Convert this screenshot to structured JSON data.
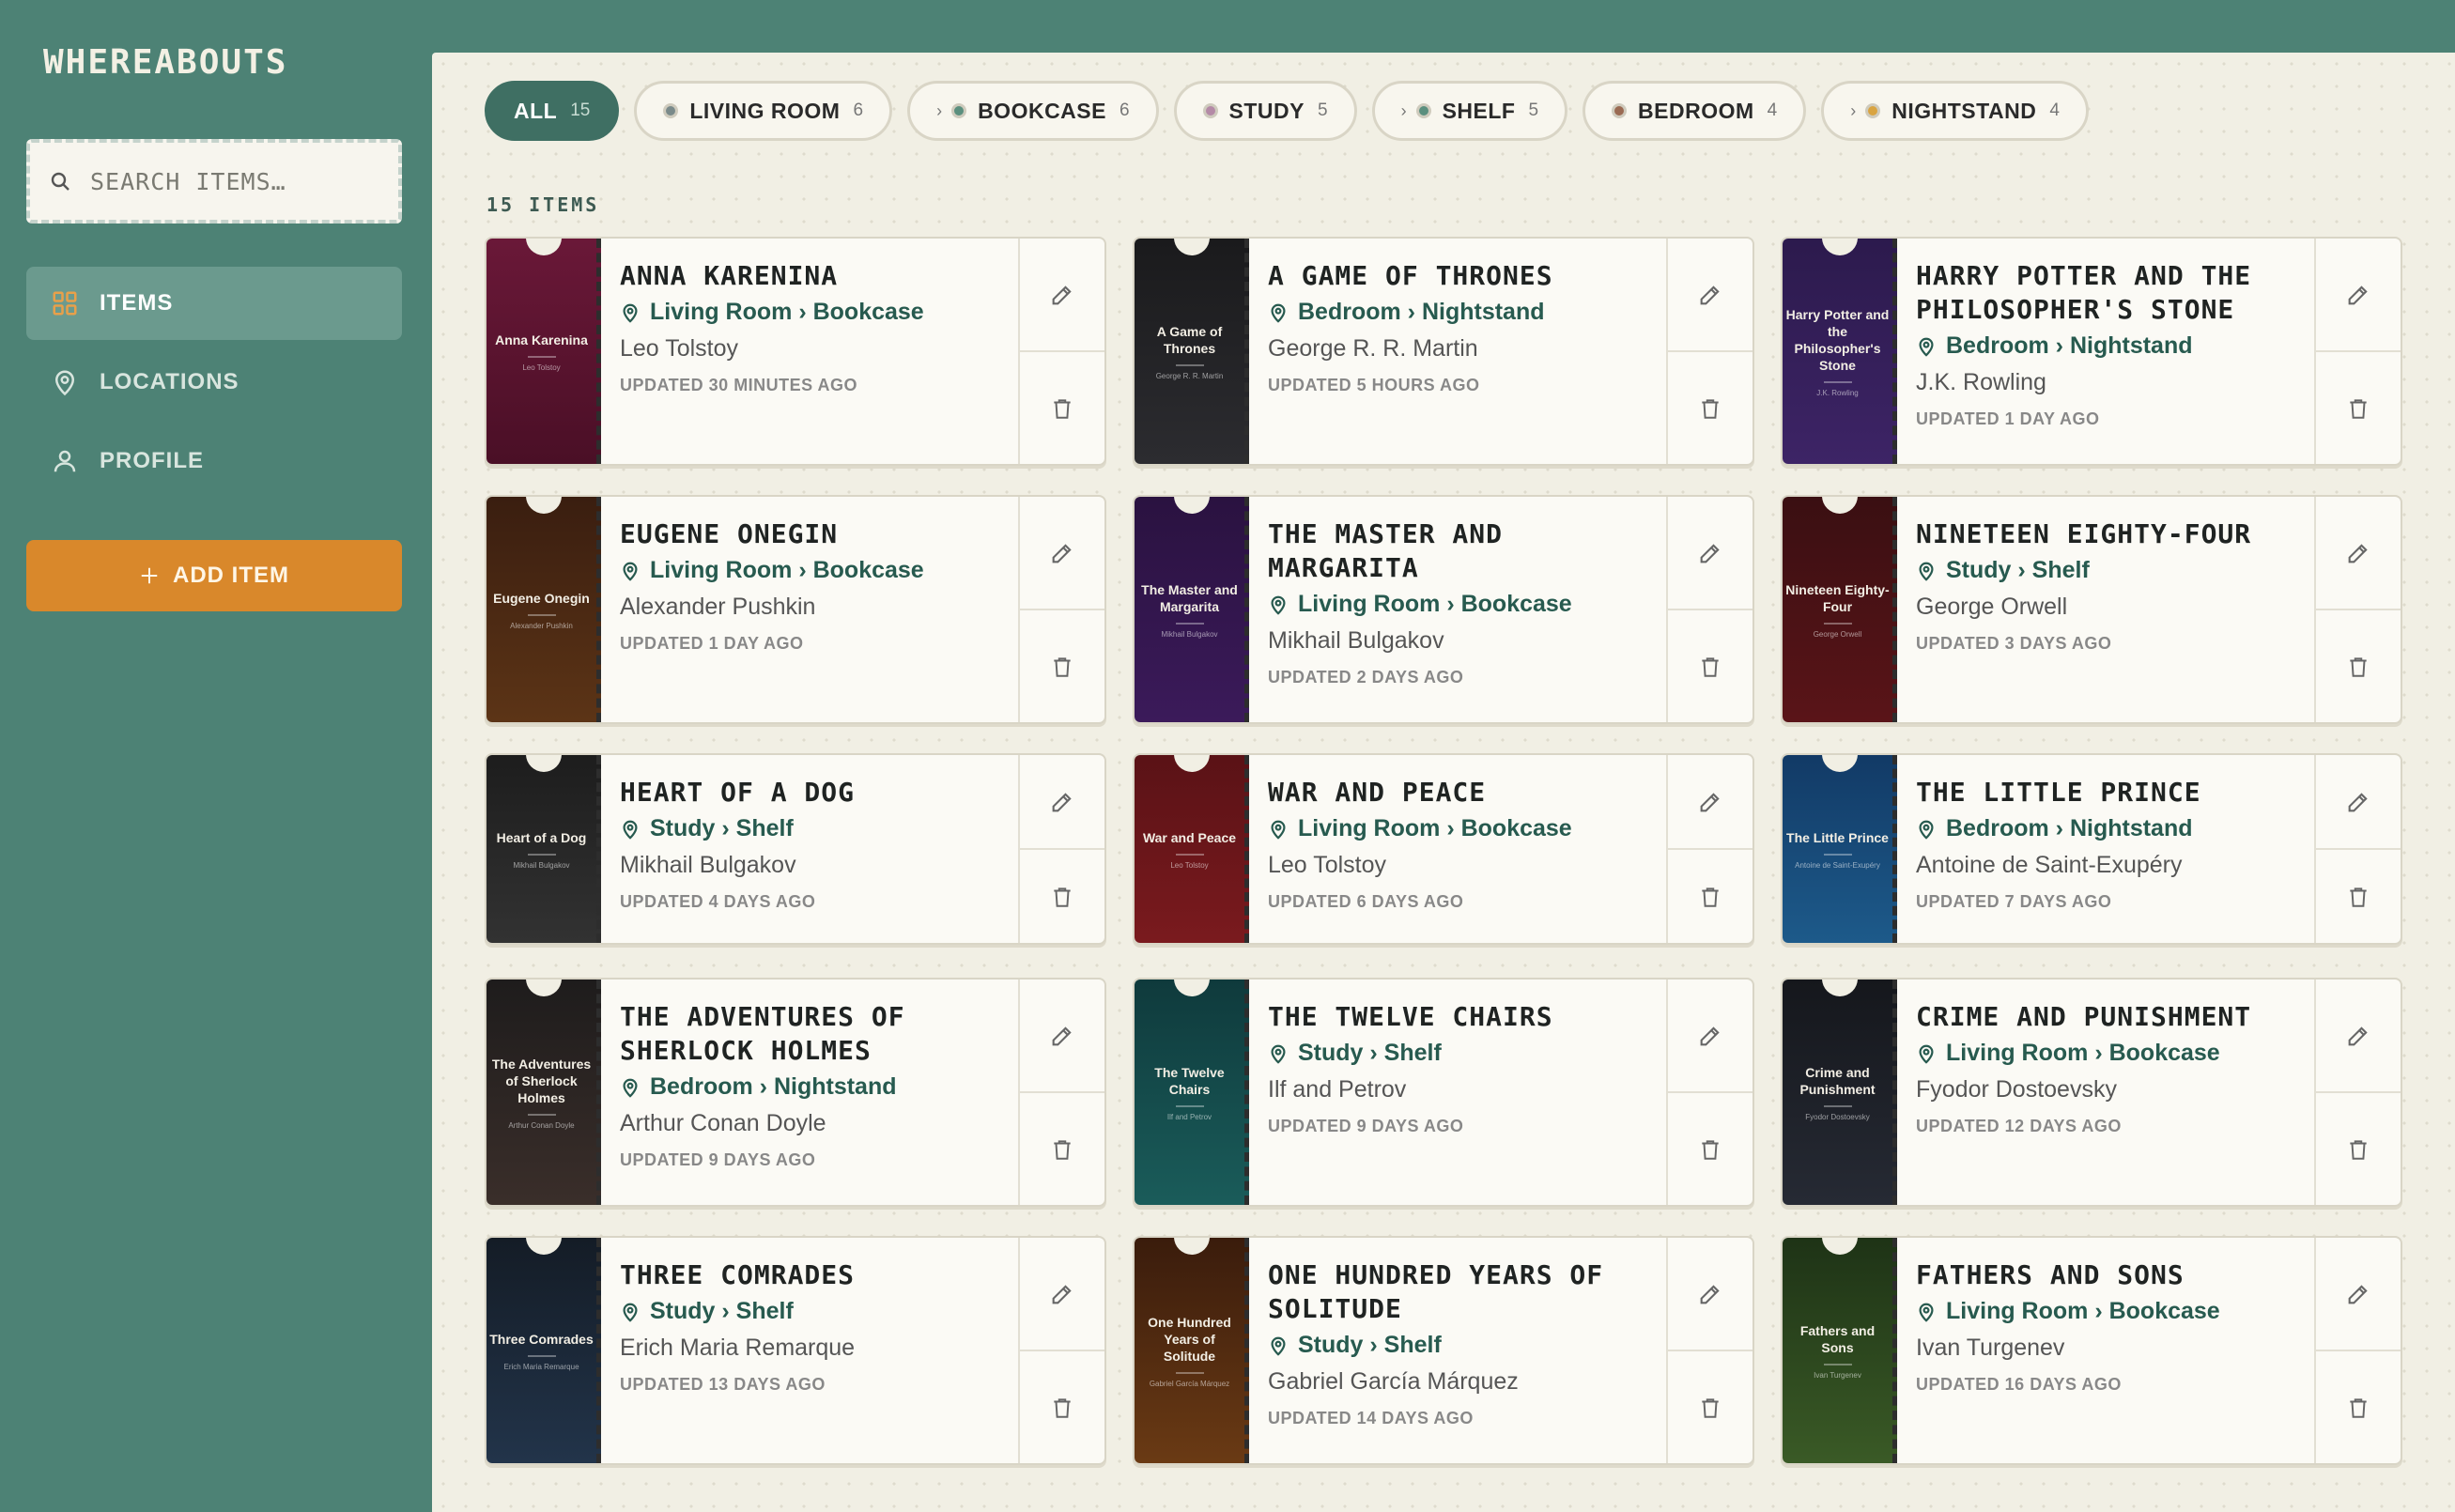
{
  "app": {
    "brand": "WHEREABOUTS"
  },
  "search": {
    "placeholder": "SEARCH ITEMS…"
  },
  "nav": [
    {
      "label": "ITEMS",
      "icon": "grid-icon",
      "active": true
    },
    {
      "label": "LOCATIONS",
      "icon": "map-pin-icon",
      "active": false
    },
    {
      "label": "PROFILE",
      "icon": "user-icon",
      "active": false
    }
  ],
  "add_button": {
    "label": "ADD ITEM"
  },
  "filters": [
    {
      "name": "ALL",
      "count": "15",
      "active": true,
      "sub": false,
      "dot": ""
    },
    {
      "name": "LIVING ROOM",
      "count": "6",
      "active": false,
      "sub": false,
      "dot": "#7a8a8a"
    },
    {
      "name": "BOOKCASE",
      "count": "6",
      "active": false,
      "sub": true,
      "dot": "#5b8f7e"
    },
    {
      "name": "STUDY",
      "count": "5",
      "active": false,
      "sub": false,
      "dot": "#b48aa6"
    },
    {
      "name": "SHELF",
      "count": "5",
      "active": false,
      "sub": true,
      "dot": "#5b8f7e"
    },
    {
      "name": "BEDROOM",
      "count": "4",
      "active": false,
      "sub": false,
      "dot": "#9a6a52"
    },
    {
      "name": "NIGHTSTAND",
      "count": "4",
      "active": false,
      "sub": true,
      "dot": "#d9a441"
    }
  ],
  "items_count": "15 ITEMS",
  "items": [
    {
      "title": "ANNA KARENINA",
      "cover_title": "Anna Karenina",
      "location": "Living Room › Bookcase",
      "author": "Leo Tolstoy",
      "updated": "UPDATED 30 MINUTES AGO",
      "color_top": "#6a1838",
      "color_bottom": "#4a0f26"
    },
    {
      "title": "A GAME OF THRONES",
      "cover_title": "A Game of Thrones",
      "location": "Bedroom › Nightstand",
      "author": "George R. R. Martin",
      "updated": "UPDATED 5 HOURS AGO",
      "color_top": "#1a1a1c",
      "color_bottom": "#2c2c30"
    },
    {
      "title": "HARRY POTTER AND THE PHILOSOPHER'S STONE",
      "cover_title": "Harry Potter and the Philosopher's Stone",
      "location": "Bedroom › Nightstand",
      "author": "J.K. Rowling",
      "updated": "UPDATED 1 DAY AGO",
      "color_top": "#2c1a4d",
      "color_bottom": "#3d2466"
    },
    {
      "title": "EUGENE ONEGIN",
      "cover_title": "Eugene Onegin",
      "location": "Living Room › Bookcase",
      "author": "Alexander Pushkin",
      "updated": "UPDATED 1 DAY AGO",
      "color_top": "#3a1e10",
      "color_bottom": "#5c3416"
    },
    {
      "title": "THE MASTER AND MARGARITA",
      "cover_title": "The Master and Margarita",
      "location": "Living Room › Bookcase",
      "author": "Mikhail Bulgakov",
      "updated": "UPDATED 2 DAYS AGO",
      "color_top": "#2a1240",
      "color_bottom": "#3b1a5a"
    },
    {
      "title": "NINETEEN EIGHTY-FOUR",
      "cover_title": "Nineteen Eighty-Four",
      "location": "Study › Shelf",
      "author": "George Orwell",
      "updated": "UPDATED 3 DAYS AGO",
      "color_top": "#3a0f12",
      "color_bottom": "#5a1418"
    },
    {
      "title": "HEART OF A DOG",
      "cover_title": "Heart of a Dog",
      "location": "Study › Shelf",
      "author": "Mikhail Bulgakov",
      "updated": "UPDATED 4 DAYS AGO",
      "color_top": "#1d1d1d",
      "color_bottom": "#323232"
    },
    {
      "title": "WAR AND PEACE",
      "cover_title": "War and Peace",
      "location": "Living Room › Bookcase",
      "author": "Leo Tolstoy",
      "updated": "UPDATED 6 DAYS AGO",
      "color_top": "#5a1216",
      "color_bottom": "#7a1a1e"
    },
    {
      "title": "THE LITTLE PRINCE",
      "cover_title": "The Little Prince",
      "location": "Bedroom › Nightstand",
      "author": "Antoine de Saint-Exupéry",
      "updated": "UPDATED 7 DAYS AGO",
      "color_top": "#123a66",
      "color_bottom": "#1d5a8a"
    },
    {
      "title": "THE ADVENTURES OF SHERLOCK HOLMES",
      "cover_title": "The Adventures of Sherlock Holmes",
      "location": "Bedroom › Nightstand",
      "author": "Arthur Conan Doyle",
      "updated": "UPDATED 9 DAYS AGO",
      "color_top": "#1e1c1c",
      "color_bottom": "#3a2e2a"
    },
    {
      "title": "THE TWELVE CHAIRS",
      "cover_title": "The Twelve Chairs",
      "location": "Study › Shelf",
      "author": "Ilf and Petrov",
      "updated": "UPDATED 9 DAYS AGO",
      "color_top": "#0f3a3c",
      "color_bottom": "#1a5c5a"
    },
    {
      "title": "CRIME AND PUNISHMENT",
      "cover_title": "Crime and Punishment",
      "location": "Living Room › Bookcase",
      "author": "Fyodor Dostoevsky",
      "updated": "UPDATED 12 DAYS AGO",
      "color_top": "#15171c",
      "color_bottom": "#262a34"
    },
    {
      "title": "THREE COMRADES",
      "cover_title": "Three Comrades",
      "location": "Study › Shelf",
      "author": "Erich Maria Remarque",
      "updated": "UPDATED 13 DAYS AGO",
      "color_top": "#141c26",
      "color_bottom": "#22344a"
    },
    {
      "title": "ONE HUNDRED YEARS OF SOLITUDE",
      "cover_title": "One Hundred Years of Solitude",
      "location": "Study › Shelf",
      "author": "Gabriel García Márquez",
      "updated": "UPDATED 14 DAYS AGO",
      "color_top": "#3a1c0c",
      "color_bottom": "#6a3a14"
    },
    {
      "title": "FATHERS AND SONS",
      "cover_title": "Fathers and Sons",
      "location": "Living Room › Bookcase",
      "author": "Ivan Turgenev",
      "updated": "UPDATED 16 DAYS AGO",
      "color_top": "#1e3316",
      "color_bottom": "#3a5a26"
    }
  ]
}
